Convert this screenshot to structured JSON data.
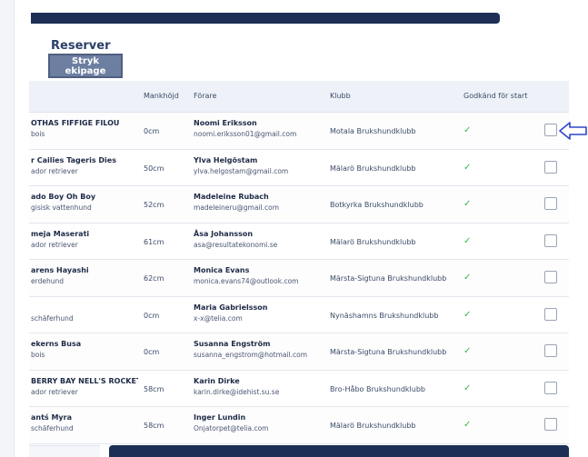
{
  "section": {
    "title": "Reserver"
  },
  "actions": {
    "stryk_label": "Stryk ekipage"
  },
  "table": {
    "headers": {
      "mankhojd": "Mankhöjd",
      "forare": "Förare",
      "klubb": "Klubb",
      "godkand": "Godkänd för start"
    },
    "rows": [
      {
        "dog": "OTHAS FIFFIGE FILOU",
        "breed": "bois",
        "height": "0cm",
        "handler": "Noomi Eriksson",
        "email": "noomi.eriksson01@gmail.com",
        "club": "Motala Brukshundklubb",
        "approved": "✓"
      },
      {
        "dog": "r Cailies Tageris Dies",
        "breed": "ador retriever",
        "height": "50cm",
        "handler": "Ylva Helgöstam",
        "email": "ylva.helgostam@gmail.com",
        "club": "Mälarö Brukshundklubb",
        "approved": "✓"
      },
      {
        "dog": "ado Boy Oh Boy",
        "breed": "gisisk vattenhund",
        "height": "52cm",
        "handler": "Madeleine Rubach",
        "email": "madeleineru@gmail.com",
        "club": "Botkyrka Brukshundklubb",
        "approved": "✓"
      },
      {
        "dog": "meja Maserati",
        "breed": "ador retriever",
        "height": "61cm",
        "handler": "Åsa Johansson",
        "email": "asa@resultatekonomi.se",
        "club": "Mälarö Brukshundklubb",
        "approved": "✓"
      },
      {
        "dog": "arens Hayashi",
        "breed": "erdehund",
        "height": "62cm",
        "handler": "Monica Evans",
        "email": "monica.evans74@outlook.com",
        "club": "Märsta-Sigtuna Brukshundklubb",
        "approved": "✓"
      },
      {
        "dog": "",
        "breed": "schäferhund",
        "height": "0cm",
        "handler": "Maria Gabrielsson",
        "email": "x-x@telia.com",
        "club": "Nynäshamns Brukshundklubb",
        "approved": "✓"
      },
      {
        "dog": "ekerns Busa",
        "breed": "bois",
        "height": "0cm",
        "handler": "Susanna Engström",
        "email": "susanna_engstrom@hotmail.com",
        "club": "Märsta-Sigtuna Brukshundklubb",
        "approved": "✓"
      },
      {
        "dog": "BERRY BAY NELL'S ROCKET",
        "breed": "ador retriever",
        "height": "58cm",
        "handler": "Karin Dirke",
        "email": "karin.dirke@idehist.su.se",
        "club": "Bro-Håbo Brukshundklubb",
        "approved": "✓"
      },
      {
        "dog": "antś Myra",
        "breed": "schäferhund",
        "height": "58cm",
        "handler": "Inger Lundin",
        "email": "Onjatorpet@telia.com",
        "club": "Mälarö Brukshundklubb",
        "approved": "✓"
      }
    ]
  },
  "icons": {
    "pointer": "arrow-left-outline-icon",
    "checkmark": "checkmark-icon",
    "checkbox": "checkbox-icon"
  },
  "colors": {
    "navy": "#1d2f55",
    "button": "#6d7fa1",
    "check": "#39b54a",
    "arrow": "#2f46c8"
  }
}
